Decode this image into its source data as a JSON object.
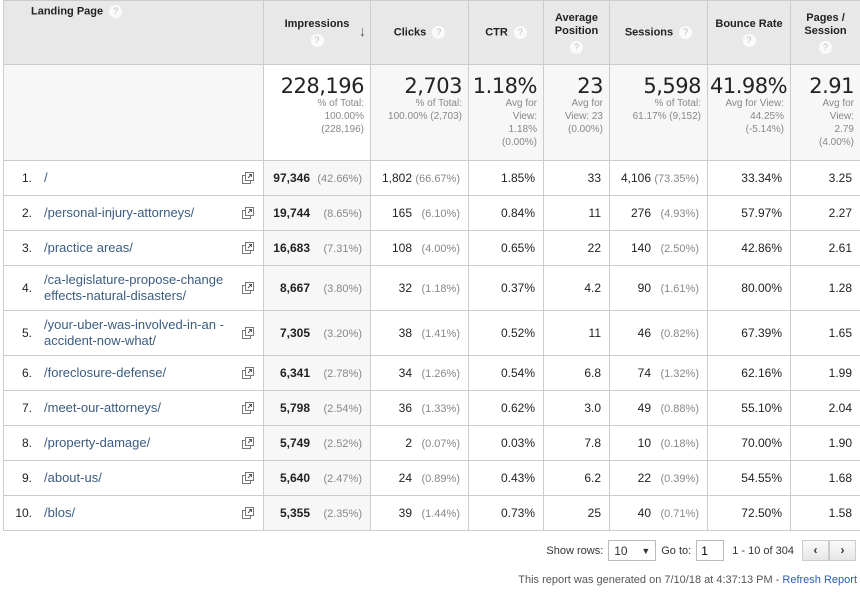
{
  "columns": {
    "landing_page": "Landing Page",
    "impressions": "Impressions",
    "clicks": "Clicks",
    "ctr": "CTR",
    "avg_position": "Average Position",
    "sessions": "Sessions",
    "bounce_rate": "Bounce Rate",
    "pages_session": "Pages / Session",
    "help_icon": "?",
    "sort_icon": "↓"
  },
  "summary": {
    "impressions": {
      "value": "228,196",
      "sub": "% of Total:\n100.00%\n(228,196)"
    },
    "clicks": {
      "value": "2,703",
      "sub": "% of Total:\n100.00% (2,703)"
    },
    "ctr": {
      "value": "1.18%",
      "sub": "Avg for\nView:\n1.18%\n(0.00%)"
    },
    "avg_position": {
      "value": "23",
      "sub": "Avg for\nView: 23\n(0.00%)"
    },
    "sessions": {
      "value": "5,598",
      "sub": "% of Total:\n61.17% (9,152)"
    },
    "bounce_rate": {
      "value": "41.98%",
      "sub": "Avg for View:\n44.25%\n(-5.14%)"
    },
    "pages_session": {
      "value": "2.91",
      "sub": "Avg for\nView:\n2.79\n(4.00%)"
    }
  },
  "rows": [
    {
      "idx": "1.",
      "page": "/",
      "impressions": "97,346",
      "impressions_pct": "(42.66%)",
      "clicks": "1,802",
      "clicks_pct": "(66.67%)",
      "ctr": "1.85%",
      "avg_position": "33",
      "sessions": "4,106",
      "sessions_pct": "(73.35%)",
      "bounce_rate": "33.34%",
      "pages_session": "3.25"
    },
    {
      "idx": "2.",
      "page": "/personal-injury-attorneys/",
      "impressions": "19,744",
      "impressions_pct": "(8.65%)",
      "clicks": "165",
      "clicks_pct": "(6.10%)",
      "ctr": "0.84%",
      "avg_position": "11",
      "sessions": "276",
      "sessions_pct": "(4.93%)",
      "bounce_rate": "57.97%",
      "pages_session": "2.27"
    },
    {
      "idx": "3.",
      "page": "/practice areas/",
      "impressions": "16,683",
      "impressions_pct": "(7.31%)",
      "clicks": "108",
      "clicks_pct": "(4.00%)",
      "ctr": "0.65%",
      "avg_position": "22",
      "sessions": "140",
      "sessions_pct": "(2.50%)",
      "bounce_rate": "42.86%",
      "pages_session": "2.61"
    },
    {
      "idx": "4.",
      "page": "/ca-legislature-propose-change effects-natural-disasters/",
      "impressions": "8,667",
      "impressions_pct": "(3.80%)",
      "clicks": "32",
      "clicks_pct": "(1.18%)",
      "ctr": "0.37%",
      "avg_position": "4.2",
      "sessions": "90",
      "sessions_pct": "(1.61%)",
      "bounce_rate": "80.00%",
      "pages_session": "1.28"
    },
    {
      "idx": "5.",
      "page": "/your-uber-was-involved-in-an -accident-now-what/",
      "impressions": "7,305",
      "impressions_pct": "(3.20%)",
      "clicks": "38",
      "clicks_pct": "(1.41%)",
      "ctr": "0.52%",
      "avg_position": "11",
      "sessions": "46",
      "sessions_pct": "(0.82%)",
      "bounce_rate": "67.39%",
      "pages_session": "1.65"
    },
    {
      "idx": "6.",
      "page": "/foreclosure-defense/",
      "impressions": "6,341",
      "impressions_pct": "(2.78%)",
      "clicks": "34",
      "clicks_pct": "(1.26%)",
      "ctr": "0.54%",
      "avg_position": "6.8",
      "sessions": "74",
      "sessions_pct": "(1.32%)",
      "bounce_rate": "62.16%",
      "pages_session": "1.99"
    },
    {
      "idx": "7.",
      "page": "/meet-our-attorneys/",
      "impressions": "5,798",
      "impressions_pct": "(2.54%)",
      "clicks": "36",
      "clicks_pct": "(1.33%)",
      "ctr": "0.62%",
      "avg_position": "3.0",
      "sessions": "49",
      "sessions_pct": "(0.88%)",
      "bounce_rate": "55.10%",
      "pages_session": "2.04"
    },
    {
      "idx": "8.",
      "page": "/property-damage/",
      "impressions": "5,749",
      "impressions_pct": "(2.52%)",
      "clicks": "2",
      "clicks_pct": "(0.07%)",
      "ctr": "0.03%",
      "avg_position": "7.8",
      "sessions": "10",
      "sessions_pct": "(0.18%)",
      "bounce_rate": "70.00%",
      "pages_session": "1.90"
    },
    {
      "idx": "9.",
      "page": "/about-us/",
      "impressions": "5,640",
      "impressions_pct": "(2.47%)",
      "clicks": "24",
      "clicks_pct": "(0.89%)",
      "ctr": "0.43%",
      "avg_position": "6.2",
      "sessions": "22",
      "sessions_pct": "(0.39%)",
      "bounce_rate": "54.55%",
      "pages_session": "1.68"
    },
    {
      "idx": "10.",
      "page": "/blos/",
      "impressions": "5,355",
      "impressions_pct": "(2.35%)",
      "clicks": "39",
      "clicks_pct": "(1.44%)",
      "ctr": "0.73%",
      "avg_position": "25",
      "sessions": "40",
      "sessions_pct": "(0.71%)",
      "bounce_rate": "72.50%",
      "pages_session": "1.58"
    }
  ],
  "footer": {
    "show_rows_label": "Show rows:",
    "show_rows_value": "10",
    "goto_label": "Go to:",
    "goto_value": "1",
    "range_text": "1 - 10 of 304",
    "prev": "‹",
    "next": "›",
    "generated_text": "This report was generated on 7/10/18 at 4:37:13 PM - ",
    "refresh_link": "Refresh Report"
  },
  "colors": {
    "link": "#3c5c80",
    "refresh_link": "#2a5db0",
    "header_bg": "#e8e8e8"
  }
}
